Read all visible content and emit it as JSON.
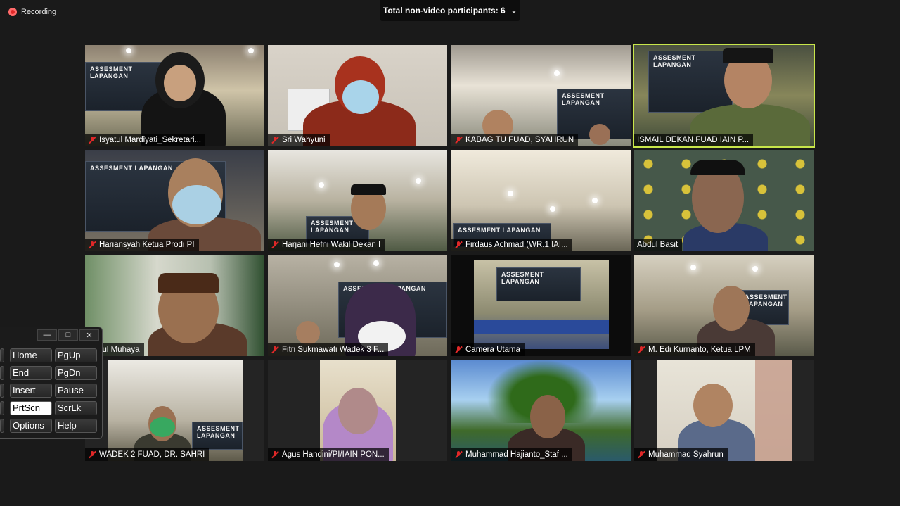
{
  "recording": {
    "label": "Recording"
  },
  "nonvideo": {
    "label": "Total non-video participants: 6"
  },
  "banner_text": "ASSESMENT LAPANGAN",
  "participants": [
    {
      "name": "Isyatul Mardiyati_Sekretari...",
      "muted": true
    },
    {
      "name": "Sri Wahyuni",
      "muted": true
    },
    {
      "name": "KABAG TU FUAD, SYAHRUN",
      "muted": true
    },
    {
      "name": "ISMAIL DEKAN FUAD IAIN P...",
      "muted": false,
      "active_speaker": true
    },
    {
      "name": "Hariansyah Ketua Prodi PI",
      "muted": true
    },
    {
      "name": "Harjani Hefni Wakil Dekan I",
      "muted": true
    },
    {
      "name": "Firdaus Achmad (WR.1 IAI...",
      "muted": true
    },
    {
      "name": "Abdul Basit",
      "muted": false
    },
    {
      "name": "Abdul Muhaya",
      "muted": false
    },
    {
      "name": "Fitri Sukmawati Wadek 3 F...",
      "muted": true
    },
    {
      "name": "Camera Utama",
      "muted": true
    },
    {
      "name": "M. Edi Kurnanto, Ketua LPM",
      "muted": true
    },
    {
      "name": "WADEK 2 FUAD, DR. SAHRI",
      "muted": true
    },
    {
      "name": "Agus Handini/PI/IAIN PON...",
      "muted": true
    },
    {
      "name": "Muhammad Hajianto_Staf ...",
      "muted": true
    },
    {
      "name": "Muhammad Syahrun",
      "muted": true
    }
  ],
  "keyboard": {
    "window_buttons": {
      "minimize": "—",
      "restore": "□",
      "close": "✕"
    },
    "keys": [
      "Home",
      "PgUp",
      "End",
      "PgDn",
      "Insert",
      "Pause",
      "PrtScn",
      "ScrLk",
      "Options",
      "Help"
    ],
    "active_key": "PrtScn"
  },
  "colors": {
    "active_speaker": "#c8e64a",
    "mute": "#e02828",
    "background": "#1a1a1a"
  }
}
